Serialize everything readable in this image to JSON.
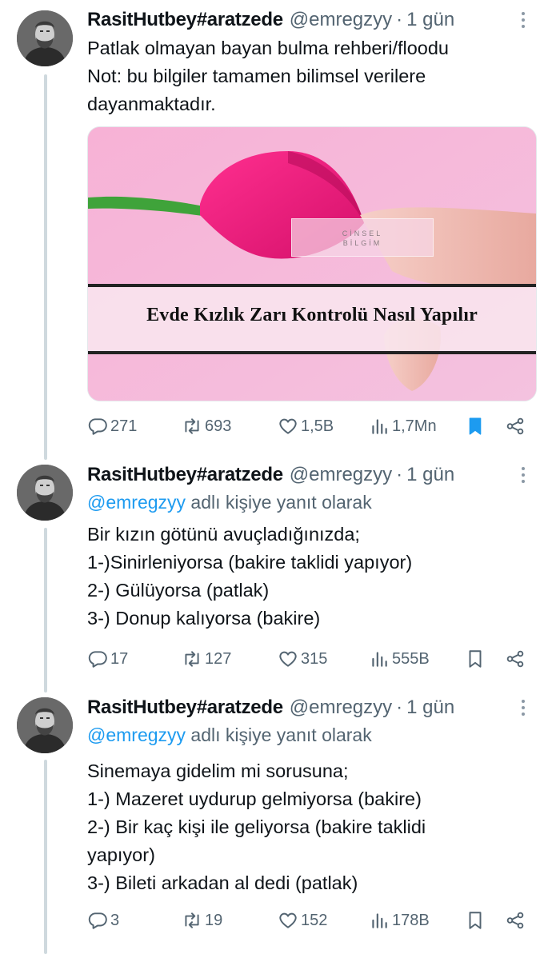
{
  "tweets": [
    {
      "name": "RasitHutbey#aratzede",
      "handle": "@emregzyy",
      "time": "1 gün",
      "reply_to": null,
      "lines": [
        "Patlak olmayan bayan bulma rehberi/floodu",
        "Not: bu bilgiler tamamen bilimsel verilere",
        "dayanmaktadır."
      ],
      "media": {
        "brand_line1": "CİNSEL",
        "brand_line2": "BİLGİM",
        "title": "Evde Kızlık Zarı Kontrolü Nasıl Yapılır"
      },
      "stats": {
        "replies": "271",
        "retweets": "693",
        "likes": "1,5B",
        "views": "1,7Mn",
        "bookmarked": true
      }
    },
    {
      "name": "RasitHutbey#aratzede",
      "handle": "@emregzyy",
      "time": "1 gün",
      "reply_to": {
        "mention": "@emregzyy",
        "suffix": " adlı kişiye yanıt olarak"
      },
      "lines": [
        "Bir kızın götünü avuçladığınızda;",
        "1-)Sinirleniyorsa (bakire taklidi yapıyor)",
        "2-) Gülüyorsa (patlak)",
        "3-) Donup kalıyorsa (bakire)"
      ],
      "stats": {
        "replies": "17",
        "retweets": "127",
        "likes": "315",
        "views": "555B",
        "bookmarked": false
      }
    },
    {
      "name": "RasitHutbey#aratzede",
      "handle": "@emregzyy",
      "time": "1 gün",
      "reply_to": {
        "mention": "@emregzyy",
        "suffix": " adlı kişiye yanıt olarak"
      },
      "lines": [
        "Sinemaya gidelim mi sorusuna;",
        "1-) Mazeret uydurup gelmiyorsa (bakire)",
        "2-) Bir kaç kişi ile geliyorsa (bakire taklidi",
        "yapıyor)",
        "3-) Bileti arkadan al dedi (patlak)"
      ],
      "stats": {
        "replies": "3",
        "retweets": "19",
        "likes": "152",
        "views": "178B",
        "bookmarked": false
      }
    }
  ],
  "colors": {
    "accent": "#1d9bf0",
    "secondary_text": "#536471",
    "thread_line": "#cfd9de"
  }
}
